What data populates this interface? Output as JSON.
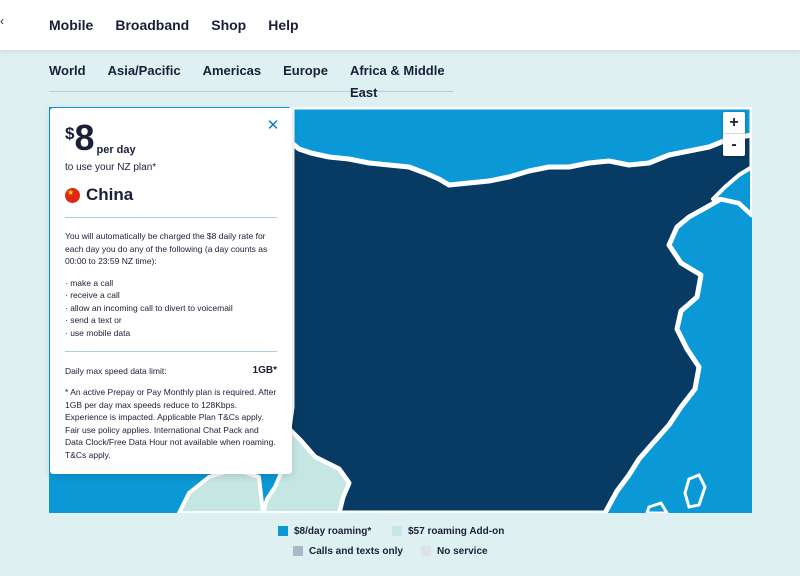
{
  "header": {
    "back_glyph": "‹",
    "nav": [
      "Mobile",
      "Broadband",
      "Shop",
      "Help"
    ]
  },
  "region_tabs": [
    "World",
    "Asia/Pacific",
    "Americas",
    "Europe",
    "Africa & Middle East"
  ],
  "zoom": {
    "in": "+",
    "out": "-"
  },
  "panel": {
    "close_glyph": "✕",
    "currency": "$",
    "amount": "8",
    "per": "per day",
    "use_plan": "to use your NZ plan*",
    "country": "China",
    "intro": "You will automatically be charged the $8 daily rate for each day you do any of the following (a day counts as 00:00 to 23:59 NZ time):",
    "bullets": [
      "· make a call",
      "· receive a call",
      "· allow an incoming call to divert to voicemail",
      "· send a text or",
      "· use mobile data"
    ],
    "data_limit_label": "Daily max speed data limit:",
    "data_limit_value": "1GB*",
    "footnote": "* An active Prepay or Pay Monthly plan is required. After 1GB per day max speeds reduce to 128Kbps. Experience is impacted. Applicable Plan T&Cs apply. Fair use policy applies. International Chat Pack and Data Clock/Free Data Hour not available when roaming. T&Cs apply."
  },
  "legend": [
    {
      "label": "$8/day roaming*",
      "color": "#0a98d6"
    },
    {
      "label": "$57 roaming Add-on",
      "color": "#c6e6e4"
    },
    {
      "label": "Calls and texts only",
      "color": "#a9b9c6"
    },
    {
      "label": "No service",
      "color": "#dfe3e6"
    }
  ],
  "colors": {
    "selected_country": "#073b63",
    "roaming_blue": "#0a98d6",
    "addon_teal": "#c6e6e4",
    "border": "#ffffff"
  }
}
